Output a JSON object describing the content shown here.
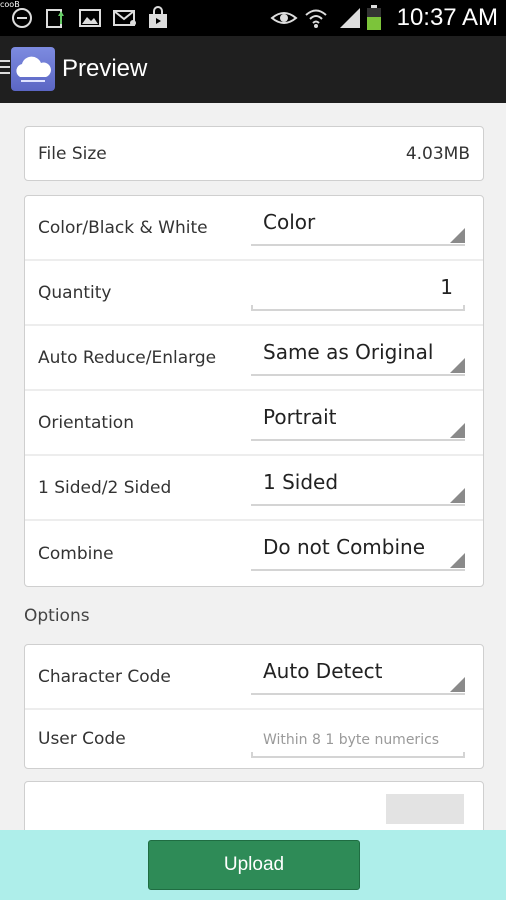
{
  "status_bar": {
    "corner_text": "cooB",
    "time": "10:37 AM",
    "icons": [
      "minus-circle-icon",
      "upload-icon",
      "image-icon",
      "email-icon",
      "shopping-bag-icon",
      "eye-icon",
      "wifi-icon",
      "signal-icon",
      "battery-icon"
    ]
  },
  "action_bar": {
    "title": "Preview",
    "icons": [
      "menu-icon",
      "cloud-app-icon"
    ]
  },
  "file_size": {
    "label": "File Size",
    "value": "4.03MB"
  },
  "settings": [
    {
      "label": "Color/Black & White",
      "value": "Color",
      "type": "spinner"
    },
    {
      "label": "Quantity",
      "value": "1",
      "type": "number"
    },
    {
      "label": "Auto Reduce/Enlarge",
      "value": "Same as Original",
      "type": "spinner"
    },
    {
      "label": "Orientation",
      "value": "Portrait",
      "type": "spinner"
    },
    {
      "label": "1 Sided/2 Sided",
      "value": "1 Sided",
      "type": "spinner"
    },
    {
      "label": "Combine",
      "value": "Do not Combine",
      "type": "spinner"
    }
  ],
  "options": {
    "title": "Options",
    "character_code": {
      "label": "Character Code",
      "value": "Auto Detect"
    },
    "user_code": {
      "label": "User Code",
      "placeholder": "Within 8 1 byte numerics"
    }
  },
  "upload_button": {
    "label": "Upload"
  },
  "colors": {
    "accent_green": "#2e8b57",
    "bottom_bar": "#aeeeea",
    "action_bar": "#1f1f1f"
  }
}
